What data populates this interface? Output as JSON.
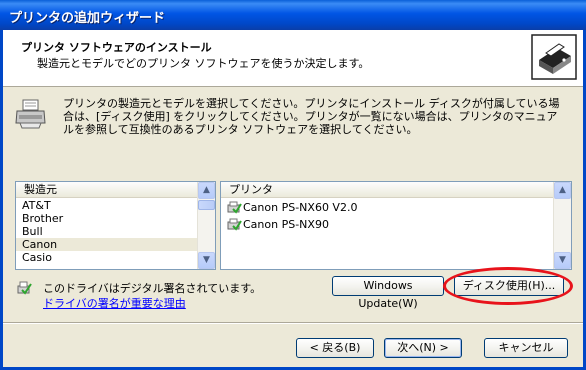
{
  "window": {
    "title": "プリンタの追加ウィザード"
  },
  "header": {
    "title": "プリンタ ソフトウェアのインストール",
    "subtitle": "製造元とモデルでどのプリンタ ソフトウェアを使うか決定します。"
  },
  "instruction": "プリンタの製造元とモデルを選択してください。プリンタにインストール ディスクが付属している場合は、[ディスク使用] をクリックしてください。プリンタが一覧にない場合は、プリンタのマニュアルを参照して互換性のあるプリンタ ソフトウェアを選択してください。",
  "manufacturer_list": {
    "header": "製造元",
    "items": [
      "AT&T",
      "Brother",
      "Bull",
      "Canon",
      "Casio"
    ],
    "selected": "Canon"
  },
  "printer_list": {
    "header": "プリンタ",
    "items": [
      "Canon PS-NX60 V2.0",
      "Canon PS-NX90"
    ]
  },
  "signature": {
    "text": "このドライバはデジタル署名されています。",
    "link": "ドライバの署名が重要な理由"
  },
  "buttons": {
    "windows_update": "Windows Update(W)",
    "have_disk": "ディスク使用(H)...",
    "back": "< 戻る(B)",
    "next": "次へ(N) >",
    "cancel": "キャンセル"
  },
  "colors": {
    "title_bar": "#0055e5",
    "highlight_oval": "#e8131b",
    "link": "#0000ff"
  }
}
